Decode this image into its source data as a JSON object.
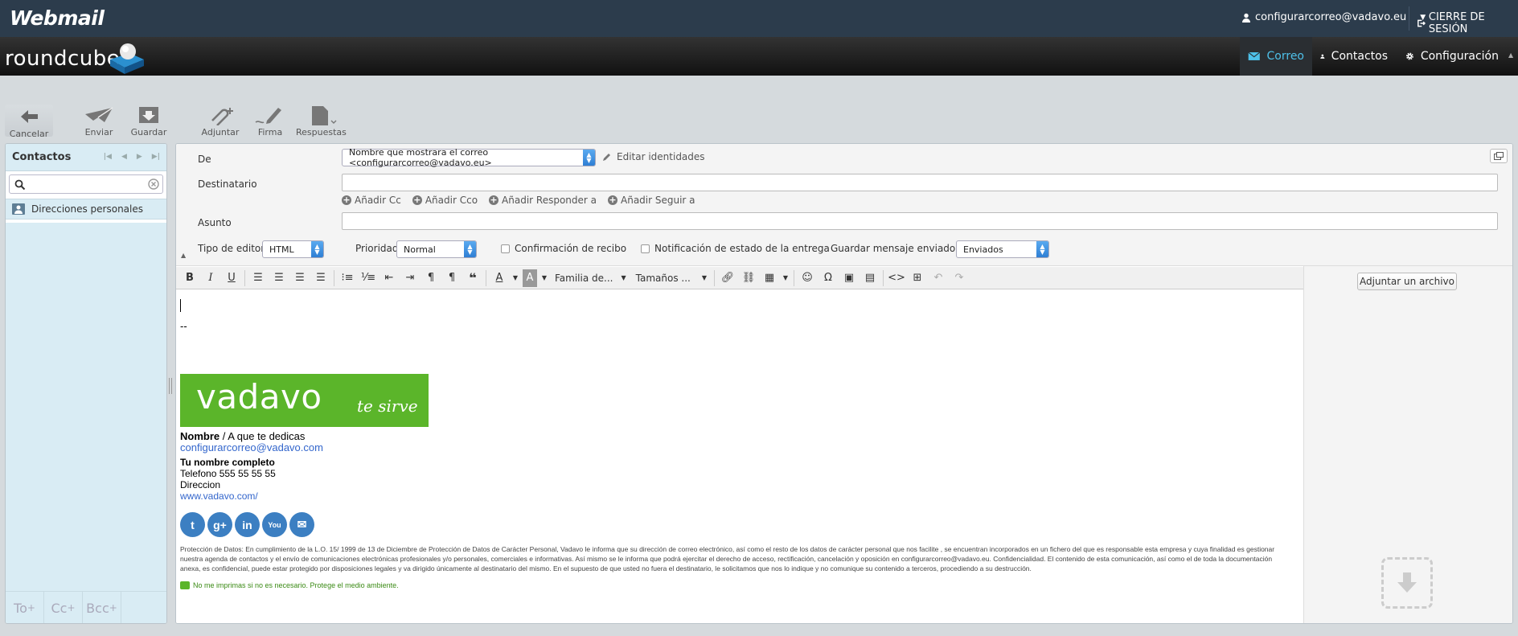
{
  "topbar": {
    "app_title": "Webmail",
    "user_email": "configurarcorreo@vadavo.eu",
    "logout_label": "CIERRE DE SESIÓN"
  },
  "header": {
    "logo_text": "roundcube",
    "nav": [
      {
        "label": "Correo",
        "icon": "mail-icon",
        "active": true
      },
      {
        "label": "Contactos",
        "icon": "user-icon",
        "active": false
      },
      {
        "label": "Configuración",
        "icon": "gear-icon",
        "active": false
      }
    ]
  },
  "toolbar": {
    "cancel": "Cancelar",
    "send": "Enviar",
    "save": "Guardar",
    "attach": "Adjuntar",
    "signature": "Firma",
    "responses": "Respuestas"
  },
  "contacts_panel": {
    "title": "Contactos",
    "search_placeholder": "",
    "group": "Direcciones personales",
    "footer": [
      "To",
      "Cc",
      "Bcc"
    ]
  },
  "compose": {
    "from_label": "De",
    "from_value": "Nombre que mostrara el correo <configurarcorreo@vadavo.eu>",
    "edit_identities": "Editar identidades",
    "to_label": "Destinatario",
    "to_value": "",
    "add_cc": "Añadir Cc",
    "add_bcc": "Añadir Cco",
    "add_reply_to": "Añadir Responder a",
    "add_followup_to": "Añadir Seguir a",
    "subject_label": "Asunto",
    "subject_value": "",
    "editor_type_label": "Tipo de editor",
    "editor_type_value": "HTML",
    "priority_label": "Prioridad",
    "priority_value": "Normal",
    "return_receipt_label": "Confirmación de recibo",
    "return_receipt_checked": false,
    "dsn_label": "Notificación de estado de la entrega",
    "dsn_checked": false,
    "save_sent_label": "Guardar mensaje enviado en",
    "save_sent_value": "Enviados"
  },
  "editor_toolbar": {
    "font_family": "Familia de...",
    "font_size": "Tamaños ..."
  },
  "attachments": {
    "button_label": "Adjuntar un archivo"
  },
  "body": {
    "separator": "--",
    "banner_name": "vadavo",
    "banner_tagline": "te sirve",
    "sig_name_bold": "Nombre",
    "sig_name_rest": " / A que te dedicas",
    "sig_email": "configurarcorreo@vadavo.com",
    "sig_fullname": "Tu nombre completo",
    "sig_phone": "Telefono 555 55 55 55",
    "sig_address": "Direccion",
    "sig_web": "www.vadavo.com/",
    "social": [
      "twitter-icon",
      "google-plus-icon",
      "linkedin-icon",
      "youtube-icon",
      "email-icon"
    ],
    "legal": "Protección de Datos: En cumplimiento de la L.O. 15/ 1999 de 13 de Diciembre de Protección de Datos de Carácter Personal, Vadavo le informa que su dirección de correo electrónico, así como el resto de los datos de carácter personal que nos facilite , se encuentran incorporados en un fichero del que es responsable esta empresa y cuya finalidad es gestionar nuestra agenda de contactos y el envío de comunicaciones electrónicas profesionales y/o personales, comerciales e informativas. Así mismo se le informa que podrá ejercitar el derecho de acceso, rectificación, cancelación y oposición en configurarcorreo@vadavo.eu. Confidencialidad. El contenido de esta comunicación, así como el de toda la documentación anexa, es confidencial, puede estar protegido por disposiciones legales y va dirigido únicamente al destinatario del mismo. En el supuesto de que usted no fuera el destinatario, le solicitamos que nos lo indique y no comunique su contenido a terceros, procediendo a su destrucción.",
    "eco_note": "No me imprimas si no es necesario. Protege el medio ambiente."
  },
  "colors": {
    "topbar": "#2c3c4c",
    "accent": "#4ec1ea",
    "vadavo_green": "#5bb52a",
    "link": "#3366cc"
  }
}
